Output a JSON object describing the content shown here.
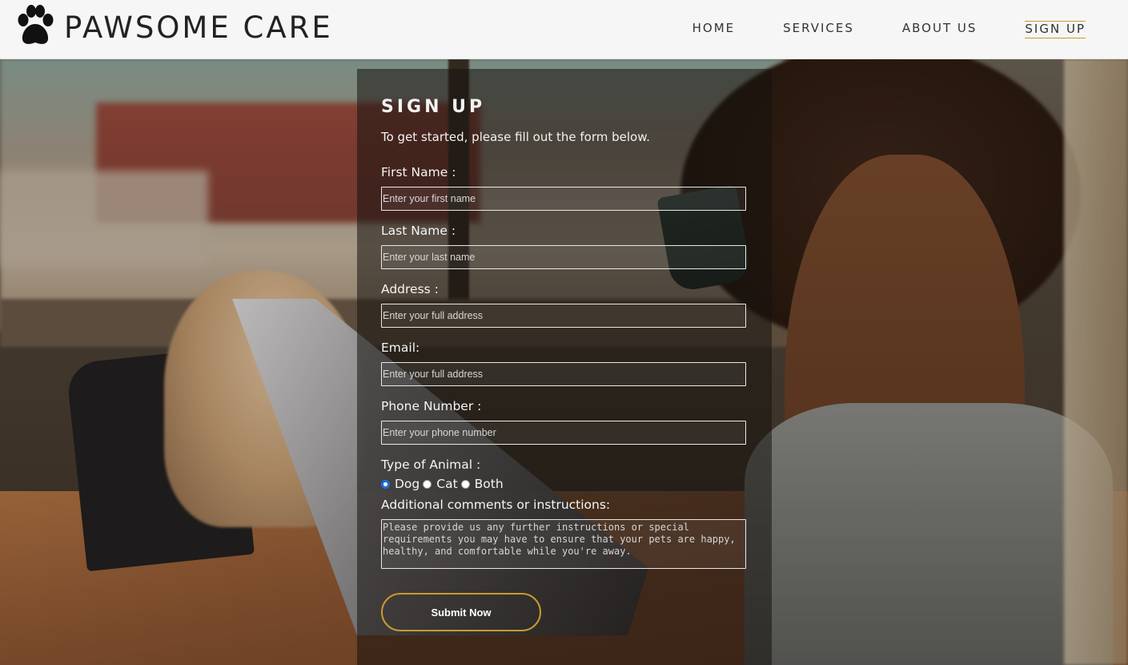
{
  "brand": {
    "name": "PAWSOME CARE",
    "logo_icon": "paw-print-icon"
  },
  "nav": {
    "items": [
      {
        "label": "HOME",
        "active": false
      },
      {
        "label": "SERVICES",
        "active": false
      },
      {
        "label": "ABOUT US",
        "active": false
      },
      {
        "label": "SIGN UP",
        "active": true
      }
    ],
    "accent": "#c99a2e"
  },
  "form": {
    "title": "SIGN UP",
    "subtitle": "To get started, please fill out the form below.",
    "fields": {
      "first_name": {
        "label": "First Name :",
        "placeholder": "Enter your first name",
        "value": ""
      },
      "last_name": {
        "label": "Last Name :",
        "placeholder": "Enter your last name",
        "value": ""
      },
      "address": {
        "label": "Address :",
        "placeholder": "Enter your full address",
        "value": ""
      },
      "email": {
        "label": "Email:",
        "placeholder": "Enter your full address",
        "value": ""
      },
      "phone": {
        "label": "Phone Number :",
        "placeholder": "Enter your phone number",
        "value": ""
      }
    },
    "animal": {
      "label": "Type of Animal :",
      "options": [
        "Dog",
        "Cat",
        "Both"
      ],
      "selected": "Dog"
    },
    "comments": {
      "label": "Additional comments or instructions:",
      "placeholder": "Please provide us any further instructions or special requirements you may have to ensure that your pets are happy, healthy, and comfortable while you're away."
    },
    "submit_label": "Submit Now"
  }
}
